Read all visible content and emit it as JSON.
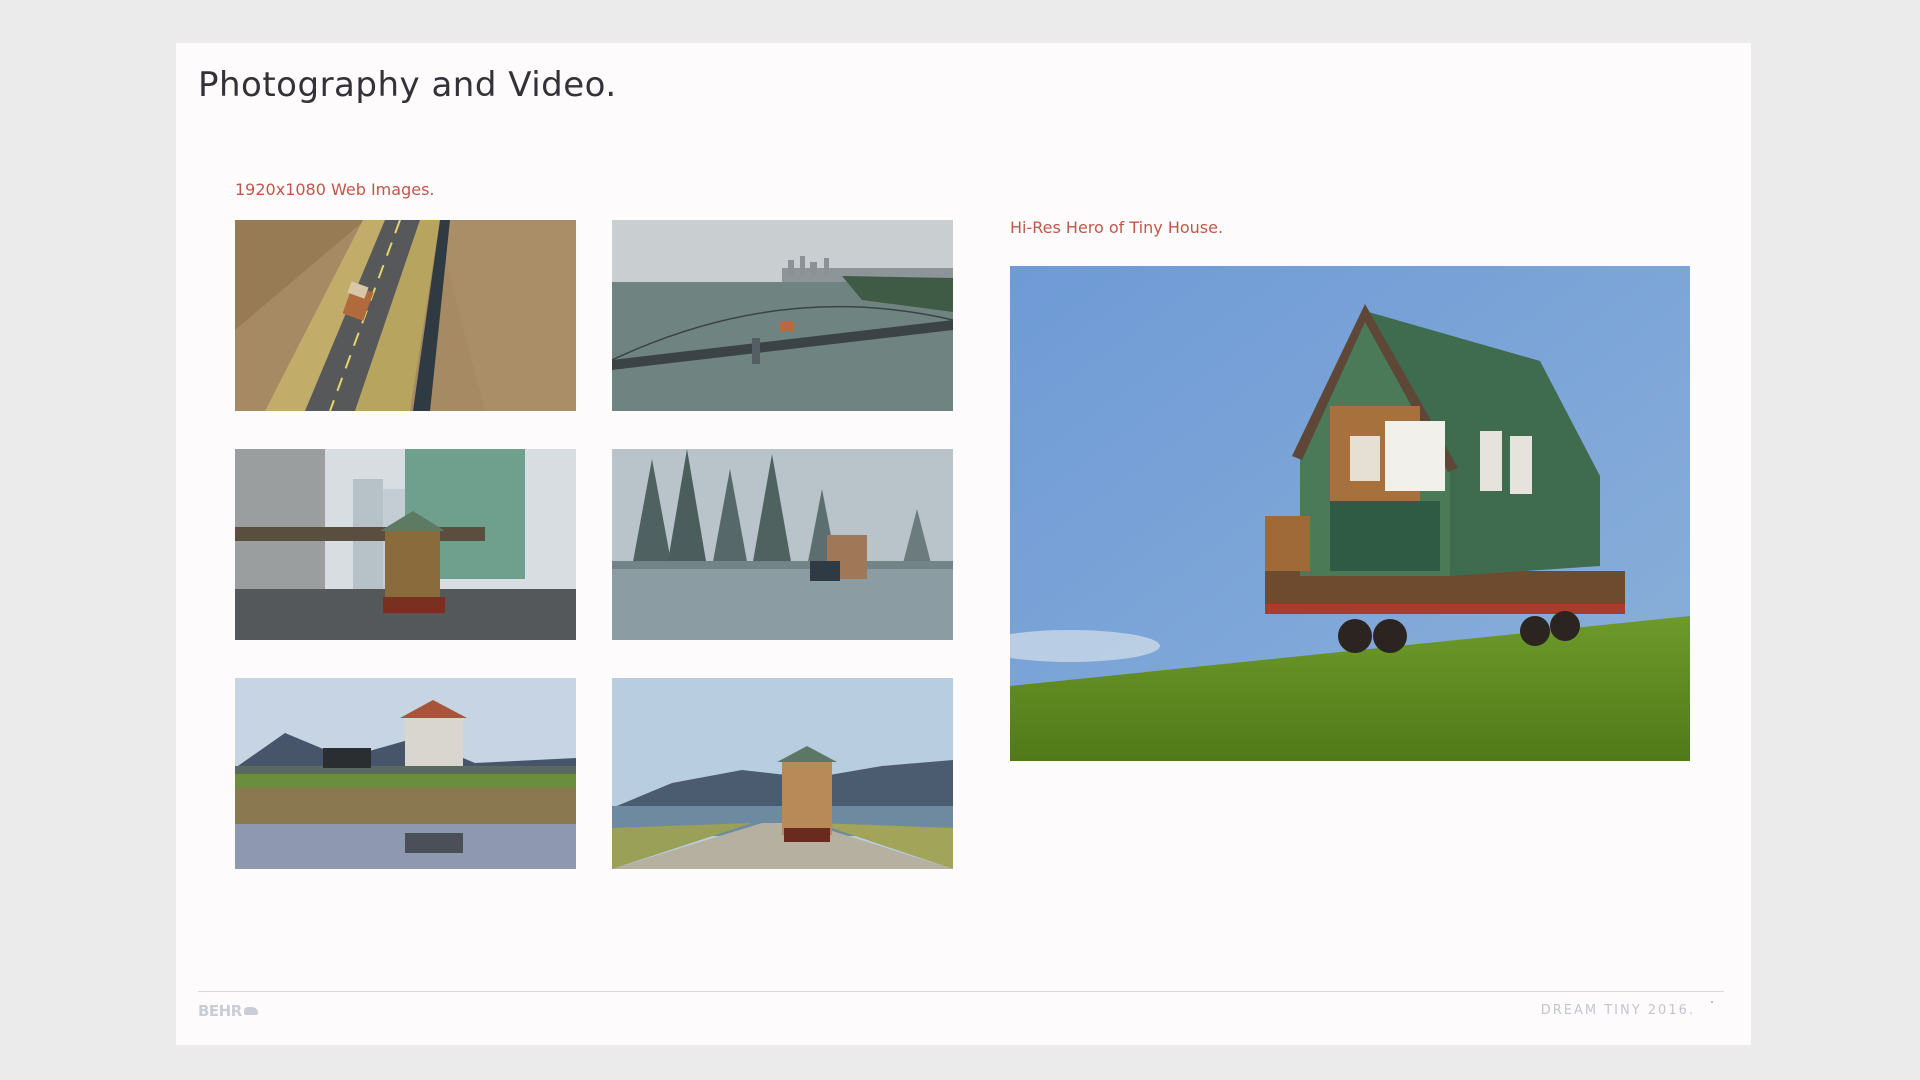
{
  "page": {
    "title": "Photography and Video.",
    "web_images_label": "1920x1080 Web Images.",
    "hero_label": "Hi-Res Hero of Tiny House."
  },
  "thumbnails": [
    {
      "name": "aerial-road-thumbnail",
      "scene": "aerial view of tiny house on truck driving down rural road between fields"
    },
    {
      "name": "bridge-thumbnail",
      "scene": "tiny house crossing a suspension bridge over water with city skyline"
    },
    {
      "name": "city-thumbnail",
      "scene": "tiny house on truck in downtown city street among towers"
    },
    {
      "name": "snow-thumbnail",
      "scene": "truck towing tiny house through snowy forest highway"
    },
    {
      "name": "field-thumbnail",
      "scene": "truck towing tiny house past field reflected in water"
    },
    {
      "name": "mountain-road-thumbnail",
      "scene": "tiny house on road with mountains and lake"
    }
  ],
  "hero": {
    "scene": "low angle view of green tiny house on trailer on grass under blue sky"
  },
  "footer": {
    "logo_text": "BEHR",
    "right_text": "DREAM TINY 2016."
  },
  "colors": {
    "accent": "#c0574a",
    "title": "#333238",
    "page_bg": "#ebebeb",
    "slide_bg": "#fdfbfc"
  }
}
